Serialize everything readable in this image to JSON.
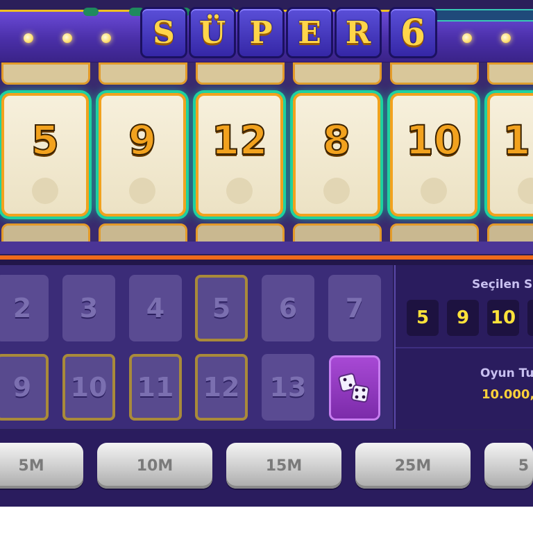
{
  "title": {
    "letters": [
      "S",
      "Ü",
      "P",
      "E",
      "R"
    ],
    "number": "6"
  },
  "cards": [
    "5",
    "9",
    "12",
    "8",
    "10",
    "1"
  ],
  "number_grid": {
    "row1": [
      "2",
      "3",
      "4",
      "5",
      "6",
      "7"
    ],
    "row2": [
      "9",
      "10",
      "11",
      "12",
      "13"
    ],
    "selected": [
      "5",
      "9",
      "10",
      "11",
      "12"
    ]
  },
  "side_panel": {
    "selected_label": "Seçilen S",
    "selected_numbers": [
      "5",
      "9",
      "10",
      ""
    ],
    "game_label": "Oyun Tu",
    "game_value": "10.000,"
  },
  "bets": [
    "5M",
    "10M",
    "15M",
    "25M",
    "5"
  ],
  "icons": {
    "random_pick": "dice-icon"
  },
  "colors": {
    "accent": "#f2a21e",
    "glow": "#1fd1a0",
    "panel": "#2a1c5e",
    "chip_text": "#ffe23a"
  }
}
